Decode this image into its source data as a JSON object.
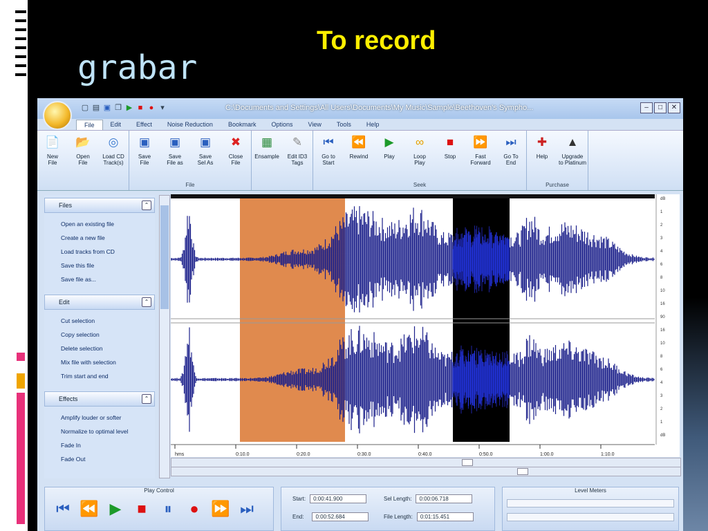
{
  "slide": {
    "title": "grabar",
    "subtitle": "To record"
  },
  "app": {
    "window_path": "C:\\Documents and Settings\\All Users\\Documents\\My Music\\Sample\\Beethoven's Sympho...",
    "qat_icons": [
      "new-icon",
      "open-icon",
      "save-icon",
      "copy-icon",
      "play-icon",
      "stop-icon",
      "record-icon",
      "dropdown-icon"
    ],
    "menu": [
      {
        "label": "File",
        "active": true
      },
      {
        "label": "Edit"
      },
      {
        "label": "Effect"
      },
      {
        "label": "Noise Reduction"
      },
      {
        "label": "Bookmark"
      },
      {
        "label": "Options"
      },
      {
        "label": "View"
      },
      {
        "label": "Tools"
      },
      {
        "label": "Help"
      }
    ],
    "ribbon_groups": [
      {
        "name": "File",
        "label": "",
        "buttons": [
          {
            "label": "New\nFile",
            "icon": "new-file-icon"
          },
          {
            "label": "Open\nFile",
            "icon": "open-folder-icon"
          },
          {
            "label": "Load CD\nTrack(s)",
            "icon": "cd-icon"
          }
        ]
      },
      {
        "name": "File2",
        "label": "File",
        "buttons": [
          {
            "label": "Save\nFile",
            "icon": "save-icon"
          },
          {
            "label": "Save\nFile as",
            "icon": "save-as-icon"
          },
          {
            "label": "Save\nSel As",
            "icon": "save-selection-icon"
          },
          {
            "label": "Close\nFile",
            "icon": "close-file-icon"
          }
        ]
      },
      {
        "name": "Tags",
        "label": "",
        "buttons": [
          {
            "label": "Ensample",
            "icon": "ensample-icon"
          },
          {
            "label": "Edit ID3\nTags",
            "icon": "tag-icon"
          }
        ]
      },
      {
        "name": "Seek",
        "label": "Seek",
        "buttons": [
          {
            "label": "Go to\nStart",
            "icon": "go-start-icon"
          },
          {
            "label": "Rewind",
            "icon": "rewind-icon"
          },
          {
            "label": "Play",
            "icon": "play-icon"
          },
          {
            "label": "Loop\nPlay",
            "icon": "loop-icon"
          },
          {
            "label": "Stop",
            "icon": "stop-icon"
          },
          {
            "label": "Fast\nForward",
            "icon": "fast-forward-icon"
          },
          {
            "label": "Go To\nEnd",
            "icon": "go-end-icon"
          }
        ]
      },
      {
        "name": "Purchase",
        "label": "Purchase",
        "buttons": [
          {
            "label": "Help",
            "icon": "help-icon"
          },
          {
            "label": "Upgrade\nto Platinum",
            "icon": "upgrade-icon"
          }
        ]
      }
    ],
    "taskpane": [
      {
        "head": "Files",
        "items": [
          "Open an existing file",
          "Create a new file",
          "Load tracks from CD",
          "Save this file",
          "Save file as..."
        ]
      },
      {
        "head": "Edit",
        "items": [
          "Cut selection",
          "Copy selection",
          "Delete selection",
          "Mix file with selection",
          "Trim start and end"
        ]
      },
      {
        "head": "Effects",
        "items": [
          "Amplify louder or softer",
          "Normalize to optimal level",
          "Fade In",
          "Fade Out"
        ]
      }
    ],
    "timeline": {
      "labels": [
        "hms",
        "0:10.0",
        "0:20.0",
        "0:30.0",
        "0:40.0",
        "0:50.0",
        "1:00.0",
        "1:10.0"
      ]
    },
    "db_scale": [
      "dB",
      "1",
      "2",
      "3",
      "4",
      "6",
      "8",
      "10",
      "16",
      "90",
      "16",
      "10",
      "8",
      "6",
      "4",
      "3",
      "2",
      "1",
      "dB"
    ],
    "play_control": {
      "title": "Play Control",
      "buttons": [
        "go-start-icon",
        "rewind-icon",
        "play-icon",
        "stop-icon",
        "pause-icon",
        "record-icon",
        "fast-forward-icon",
        "go-end-icon"
      ]
    },
    "times": {
      "start_label": "Start:",
      "start_value": "0:00:41.900",
      "end_label": "End:",
      "end_value": "0:00:52.684",
      "sel_length_label": "Sel Length:",
      "sel_length_value": "0:00:06.718",
      "file_length_label": "File Length:",
      "file_length_value": "0:01:15.451"
    },
    "level_meters": {
      "title": "Level Meters"
    },
    "colors": {
      "waveform": "#1a1f8a",
      "selection_orange": "#e08a4e",
      "selection_black": "#000000",
      "highlight_blue": "#2233dd",
      "subtitle": "#ffef00",
      "title": "#bfe3f8"
    }
  }
}
